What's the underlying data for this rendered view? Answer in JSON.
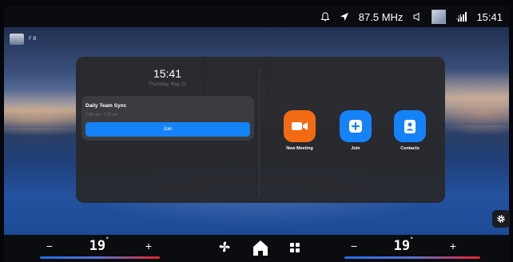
{
  "status_bar": {
    "radio_frequency": "87.5 MHz",
    "signal_label": ".ıl",
    "time": "15:41",
    "icons": [
      "bell-icon",
      "location-arrow-icon",
      "speaker-muted-icon",
      "wallpaper-thumbnail",
      "signal-icon"
    ]
  },
  "profile": {
    "name": "F B",
    "icon": "avatar"
  },
  "meeting_widget": {
    "clock": "15:41",
    "date": "Thursday, May 22",
    "meeting": {
      "title": "Daily Team Sync",
      "time": "7:00 am - 7:30 am",
      "join_label": "Join"
    }
  },
  "actions": [
    {
      "label": "New Meeting",
      "icon": "video-camera-icon",
      "color": "#f26b14"
    },
    {
      "label": "Join",
      "icon": "plus-icon",
      "color": "#1682f8"
    },
    {
      "label": "Contacts",
      "icon": "contact-card-icon",
      "color": "#1682f8"
    }
  ],
  "climate": {
    "driver_temp": "19",
    "passenger_temp": "19",
    "degree_symbol": "°",
    "minus_label": "−",
    "plus_label": "+",
    "cold_color": "#1f6fe8",
    "hot_color": "#e8232a"
  },
  "nav": [
    "fan-icon",
    "home-icon",
    "apps-grid-icon"
  ],
  "colors": {
    "accent_blue": "#1682f8",
    "accent_orange": "#f26b14",
    "panel": "#28292c"
  }
}
